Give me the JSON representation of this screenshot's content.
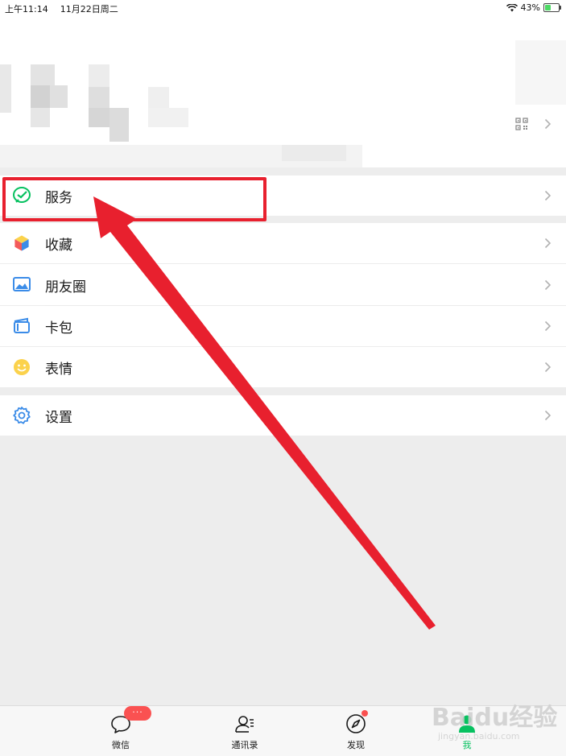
{
  "status_bar": {
    "time": "上午11:14",
    "date": "11月22日周二",
    "battery": "43%",
    "battery_level": 0.43
  },
  "profile": {
    "qr_icon": "qr-code-icon",
    "chevron_icon": "chevron-right-icon"
  },
  "menu": {
    "service": {
      "label": "服务",
      "icon": "wechat-pay-check-icon",
      "color": "#07c160"
    },
    "items": [
      {
        "label": "收藏",
        "icon": "favorites-cube-icon"
      },
      {
        "label": "朋友圈",
        "icon": "moments-picture-icon"
      },
      {
        "label": "卡包",
        "icon": "card-wallet-icon"
      },
      {
        "label": "表情",
        "icon": "sticker-smile-icon"
      }
    ],
    "settings": {
      "label": "设置",
      "icon": "gear-icon"
    }
  },
  "annotation": {
    "color": "#e8202e"
  },
  "tabbar": {
    "tabs": [
      {
        "label": "微信",
        "icon": "chat-bubble-icon"
      },
      {
        "label": "通讯录",
        "icon": "contacts-icon"
      },
      {
        "label": "发现",
        "icon": "compass-icon"
      },
      {
        "label": "我",
        "icon": "me-person-icon",
        "active": true
      }
    ],
    "chat_badge": "···",
    "active_color": "#07c160"
  },
  "watermark": {
    "text": "Baidu经验",
    "url": "jingyan.baidu.com"
  }
}
